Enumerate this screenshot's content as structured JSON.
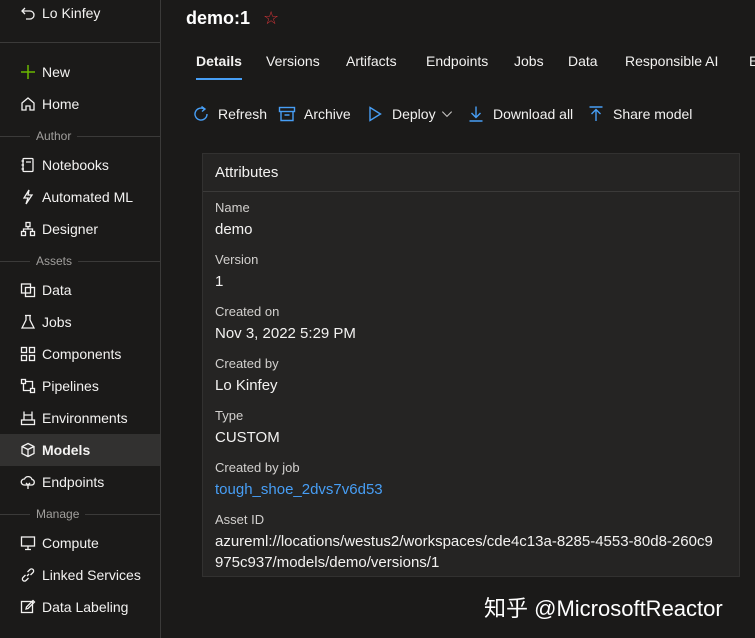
{
  "sidebar": {
    "user": "Lo Kinfey",
    "new_label": "New",
    "home_label": "Home",
    "section_author": "Author",
    "author_items": [
      {
        "label": "Notebooks",
        "icon": "notebook-icon"
      },
      {
        "label": "Automated ML",
        "icon": "automl-icon"
      },
      {
        "label": "Designer",
        "icon": "designer-icon"
      }
    ],
    "section_assets": "Assets",
    "asset_items": [
      {
        "label": "Data",
        "icon": "data-icon"
      },
      {
        "label": "Jobs",
        "icon": "flask-icon"
      },
      {
        "label": "Components",
        "icon": "components-icon"
      },
      {
        "label": "Pipelines",
        "icon": "pipelines-icon"
      },
      {
        "label": "Environments",
        "icon": "environment-icon"
      },
      {
        "label": "Models",
        "icon": "cube-icon"
      },
      {
        "label": "Endpoints",
        "icon": "cloud-endpoint-icon"
      }
    ],
    "section_manage": "Manage",
    "manage_items": [
      {
        "label": "Compute",
        "icon": "monitor-icon"
      },
      {
        "label": "Linked Services",
        "icon": "link-icon"
      },
      {
        "label": "Data Labeling",
        "icon": "edit-icon"
      }
    ]
  },
  "header": {
    "title": "demo:1",
    "favorite_icon": "star-outline-icon",
    "favorite_color": "#d13438"
  },
  "tabs": [
    "Details",
    "Versions",
    "Artifacts",
    "Endpoints",
    "Jobs",
    "Data",
    "Responsible AI",
    "E"
  ],
  "toolbar": {
    "refresh": "Refresh",
    "archive": "Archive",
    "deploy": "Deploy",
    "download_all": "Download all",
    "share_model": "Share model"
  },
  "attributes": {
    "heading": "Attributes",
    "items": [
      {
        "key": "Name",
        "value": "demo"
      },
      {
        "key": "Version",
        "value": "1"
      },
      {
        "key": "Created on",
        "value": "Nov 3, 2022 5:29 PM"
      },
      {
        "key": "Created by",
        "value": "Lo Kinfey"
      },
      {
        "key": "Type",
        "value": "CUSTOM"
      },
      {
        "key": "Created by job",
        "value": "tough_shoe_2dvs7v6d53"
      },
      {
        "key": "Asset ID",
        "value": "azureml://locations/westus2/workspaces/cde4c13a-8285-4553-80d8-260c9975c937/models/demo/versions/1"
      }
    ]
  },
  "colors": {
    "accent": "#479ef5",
    "new_plus": "#6bb700"
  },
  "watermark": "知乎 @MicrosoftReactor"
}
